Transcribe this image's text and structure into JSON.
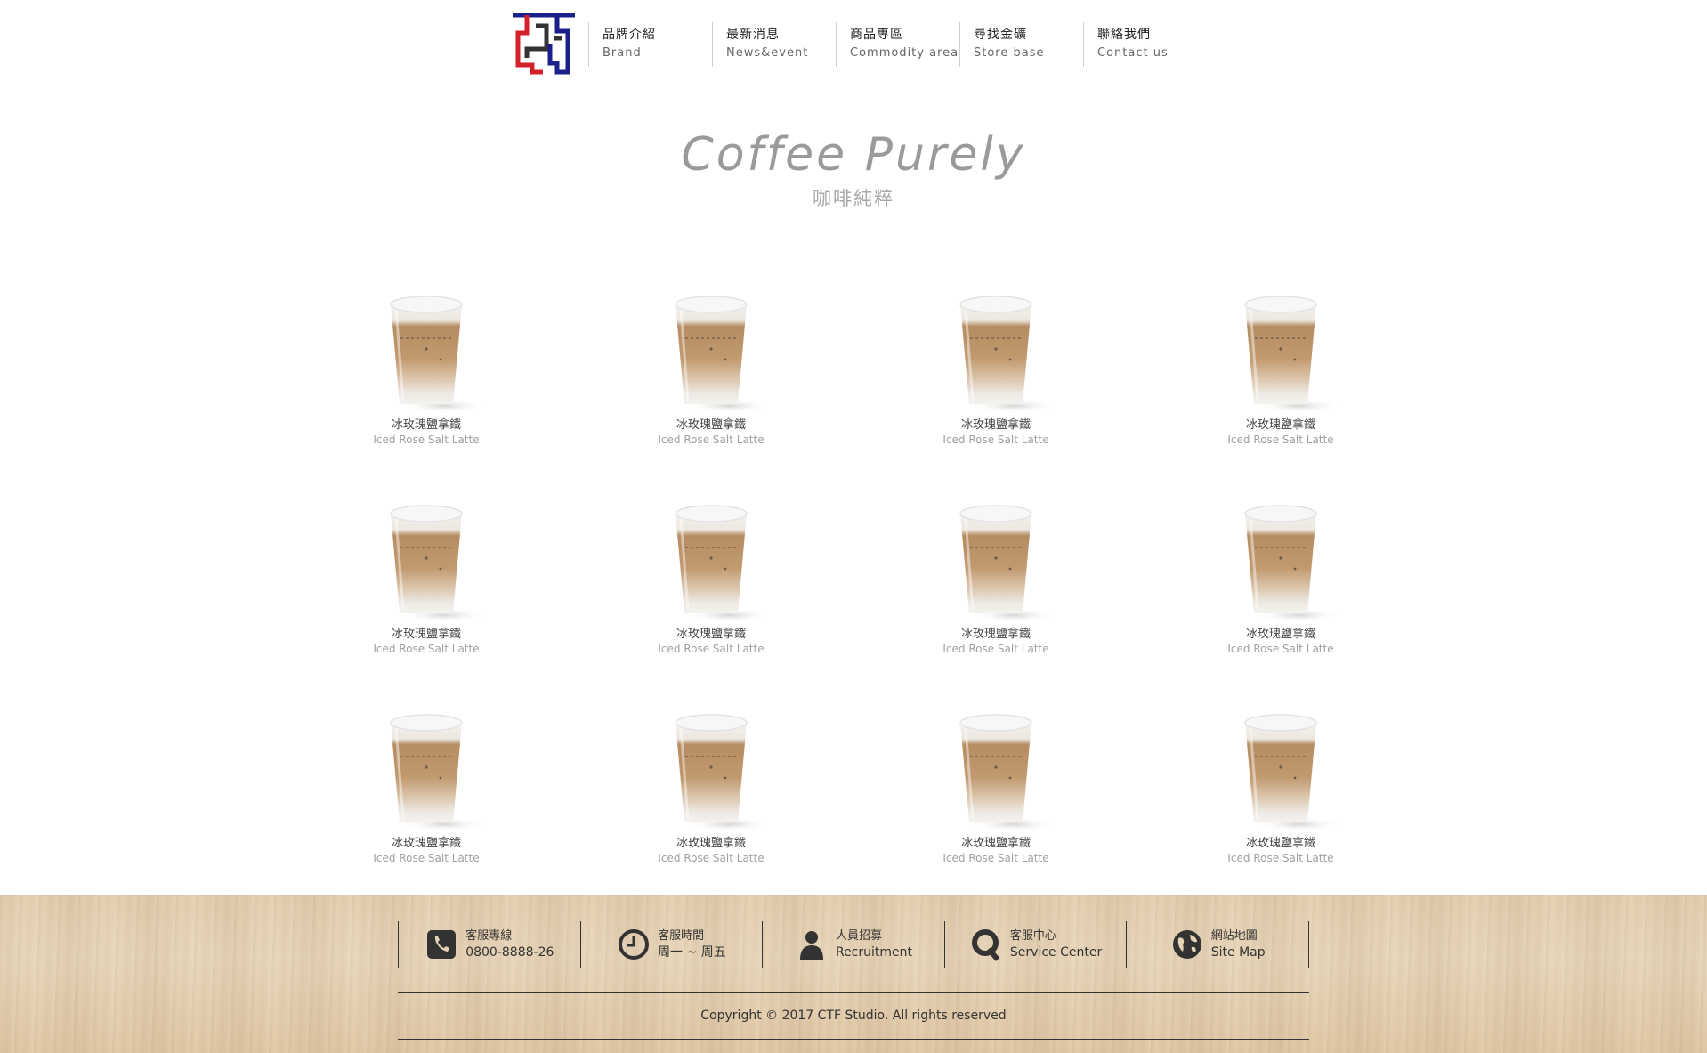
{
  "brand": {
    "logo_icon": "ctf-logo-icon",
    "colors": {
      "blue": "#1a1f8c",
      "red": "#d4202a",
      "dark": "#333333"
    }
  },
  "nav": [
    {
      "zh": "品牌介紹",
      "en": "Brand"
    },
    {
      "zh": "最新消息",
      "en": "News&event"
    },
    {
      "zh": "商品專區",
      "en": "Commodity area"
    },
    {
      "zh": "尋找金礦",
      "en": "Store base"
    },
    {
      "zh": "聯絡我們",
      "en": "Contact us"
    }
  ],
  "section": {
    "title_en": "Coffee Purely",
    "title_zh": "咖啡純粹"
  },
  "products": [
    {
      "zh": "冰玫瑰鹽拿鐵",
      "en": "Iced Rose Salt Latte"
    },
    {
      "zh": "冰玫瑰鹽拿鐵",
      "en": "Iced Rose Salt Latte"
    },
    {
      "zh": "冰玫瑰鹽拿鐵",
      "en": "Iced Rose Salt Latte"
    },
    {
      "zh": "冰玫瑰鹽拿鐵",
      "en": "Iced Rose Salt Latte"
    },
    {
      "zh": "冰玫瑰鹽拿鐵",
      "en": "Iced Rose Salt Latte"
    },
    {
      "zh": "冰玫瑰鹽拿鐵",
      "en": "Iced Rose Salt Latte"
    },
    {
      "zh": "冰玫瑰鹽拿鐵",
      "en": "Iced Rose Salt Latte"
    },
    {
      "zh": "冰玫瑰鹽拿鐵",
      "en": "Iced Rose Salt Latte"
    },
    {
      "zh": "冰玫瑰鹽拿鐵",
      "en": "Iced Rose Salt Latte"
    },
    {
      "zh": "冰玫瑰鹽拿鐵",
      "en": "Iced Rose Salt Latte"
    },
    {
      "zh": "冰玫瑰鹽拿鐵",
      "en": "Iced Rose Salt Latte"
    },
    {
      "zh": "冰玫瑰鹽拿鐵",
      "en": "Iced Rose Salt Latte"
    }
  ],
  "footer": {
    "items": [
      {
        "icon": "phone-icon",
        "line1": "客服專線",
        "line2": "0800-8888-26"
      },
      {
        "icon": "clock-icon",
        "line1": "客服時間",
        "line2": "周一 ~ 周五"
      },
      {
        "icon": "person-icon",
        "line1": "人員招募",
        "line2": "Recruitment"
      },
      {
        "icon": "q-icon",
        "line1": "客服中心",
        "line2": "Service Center"
      },
      {
        "icon": "globe-icon",
        "line1": "網站地圖",
        "line2": "Site Map"
      }
    ],
    "copyright": "Copyright © 2017 CTF Studio. All rights reserved"
  }
}
